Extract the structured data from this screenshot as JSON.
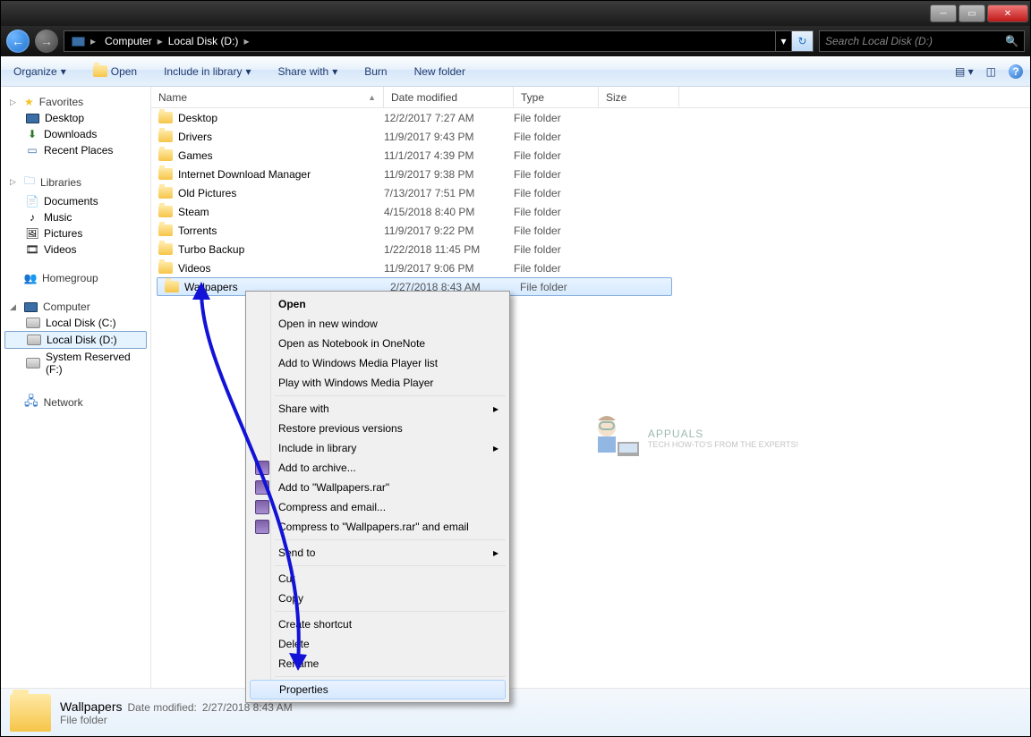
{
  "breadcrumb": {
    "root": "Computer",
    "drive": "Local Disk (D:)"
  },
  "search": {
    "placeholder": "Search Local Disk (D:)"
  },
  "toolbar": {
    "organize": "Organize",
    "open": "Open",
    "include": "Include in library",
    "share": "Share with",
    "burn": "Burn",
    "newfolder": "New folder"
  },
  "nav": {
    "favorites": "Favorites",
    "fav_items": [
      "Desktop",
      "Downloads",
      "Recent Places"
    ],
    "libraries": "Libraries",
    "lib_items": [
      "Documents",
      "Music",
      "Pictures",
      "Videos"
    ],
    "homegroup": "Homegroup",
    "computer": "Computer",
    "drives": [
      "Local Disk (C:)",
      "Local Disk (D:)",
      "System Reserved (F:)"
    ],
    "network": "Network"
  },
  "columns": {
    "name": "Name",
    "date": "Date modified",
    "type": "Type",
    "size": "Size"
  },
  "rows": [
    {
      "name": "Desktop",
      "date": "12/2/2017 7:27 AM",
      "type": "File folder"
    },
    {
      "name": "Drivers",
      "date": "11/9/2017 9:43 PM",
      "type": "File folder"
    },
    {
      "name": "Games",
      "date": "11/1/2017 4:39 PM",
      "type": "File folder"
    },
    {
      "name": "Internet Download Manager",
      "date": "11/9/2017 9:38 PM",
      "type": "File folder"
    },
    {
      "name": "Old Pictures",
      "date": "7/13/2017 7:51 PM",
      "type": "File folder"
    },
    {
      "name": "Steam",
      "date": "4/15/2018 8:40 PM",
      "type": "File folder"
    },
    {
      "name": "Torrents",
      "date": "11/9/2017 9:22 PM",
      "type": "File folder"
    },
    {
      "name": "Turbo Backup",
      "date": "1/22/2018 11:45 PM",
      "type": "File folder"
    },
    {
      "name": "Videos",
      "date": "11/9/2017 9:06 PM",
      "type": "File folder"
    },
    {
      "name": "Wallpapers",
      "date": "2/27/2018 8:43 AM",
      "type": "File folder"
    }
  ],
  "context": {
    "open": "Open",
    "open_new": "Open in new window",
    "onenote": "Open as Notebook in OneNote",
    "wmp_add": "Add to Windows Media Player list",
    "wmp_play": "Play with Windows Media Player",
    "share": "Share with",
    "restore": "Restore previous versions",
    "include": "Include in library",
    "archive": "Add to archive...",
    "add_rar": "Add to \"Wallpapers.rar\"",
    "compress": "Compress and email...",
    "compress_rar": "Compress to \"Wallpapers.rar\" and email",
    "sendto": "Send to",
    "cut": "Cut",
    "copy": "Copy",
    "shortcut": "Create shortcut",
    "delete": "Delete",
    "rename": "Rename",
    "properties": "Properties"
  },
  "details": {
    "title": "Wallpapers",
    "meta_label": "Date modified:",
    "meta_value": "2/27/2018 8:43 AM",
    "type": "File folder"
  },
  "watermark": {
    "brand": "APPUALS",
    "tag": "TECH HOW-TO'S FROM THE EXPERTS!"
  }
}
